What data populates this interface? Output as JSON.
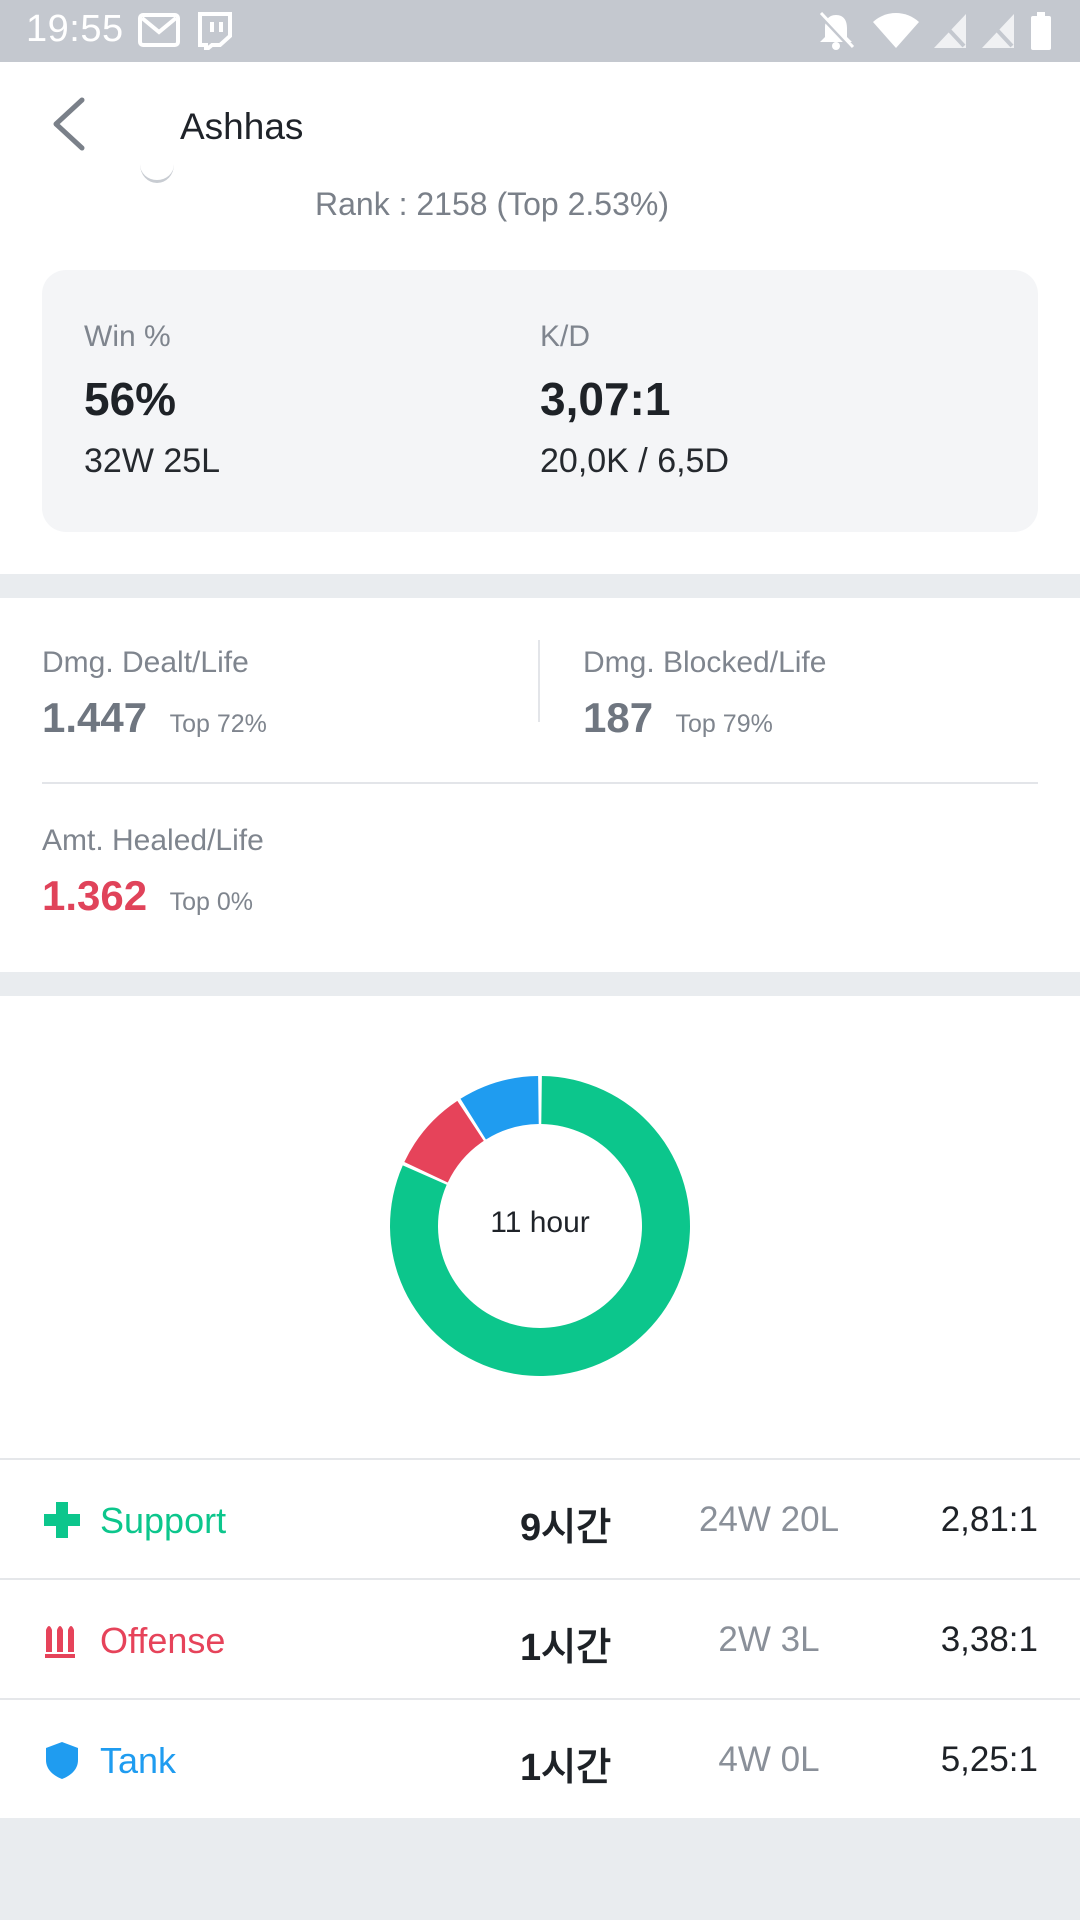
{
  "status_bar": {
    "time": "19:55"
  },
  "header": {
    "title": "Ashhas"
  },
  "rank_text": "Rank : 2158 (Top 2.53%)",
  "summary": {
    "win_label": "Win %",
    "win_value": "56%",
    "win_record": "32W 25L",
    "kd_label": "K/D",
    "kd_value": "3,07:1",
    "kd_record": "20,0K / 6,5D"
  },
  "damage": {
    "dealt_label": "Dmg. Dealt/Life",
    "dealt_value": "1.447",
    "dealt_top": "Top 72%",
    "blocked_label": "Dmg. Blocked/Life",
    "blocked_value": "187",
    "blocked_top": "Top 79%",
    "healed_label": "Amt. Healed/Life",
    "healed_value": "1.362",
    "healed_top": "Top 0%"
  },
  "chart_data": {
    "type": "pie",
    "center_label": "11 hour",
    "series": [
      {
        "name": "Support",
        "value": 9,
        "color": "#0cc68c"
      },
      {
        "name": "Offense",
        "value": 1,
        "color": "#e6435a"
      },
      {
        "name": "Tank",
        "value": 1,
        "color": "#1f9cf0"
      }
    ]
  },
  "roles": [
    {
      "name": "Support",
      "color": "#0cc68c",
      "icon": "plus-icon",
      "time": "9시간",
      "record": "24W 20L",
      "kd": "2,81:1"
    },
    {
      "name": "Offense",
      "color": "#e6435a",
      "icon": "ammo-icon",
      "time": "1시간",
      "record": "2W 3L",
      "kd": "3,38:1"
    },
    {
      "name": "Tank",
      "color": "#1f9cf0",
      "icon": "shield-icon",
      "time": "1시간",
      "record": "4W 0L",
      "kd": "5,25:1"
    }
  ]
}
